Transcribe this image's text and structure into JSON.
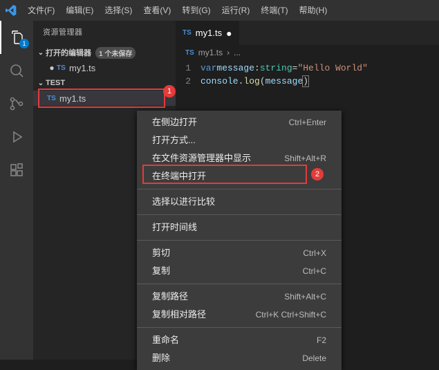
{
  "menubar": {
    "items": [
      "文件(F)",
      "编辑(E)",
      "选择(S)",
      "查看(V)",
      "转到(G)",
      "运行(R)",
      "终端(T)",
      "帮助(H)"
    ]
  },
  "activitybar": {
    "badge": "1"
  },
  "sidebar": {
    "title": "资源管理器",
    "openEditors": {
      "label": "打开的编辑器",
      "badge": "1 个未保存"
    },
    "openFiles": [
      {
        "dot": "●",
        "icon": "TS",
        "name": "my1.ts"
      }
    ],
    "folder": {
      "label": "TEST"
    },
    "folderFiles": [
      {
        "icon": "TS",
        "name": "my1.ts"
      }
    ]
  },
  "editor": {
    "tab": {
      "icon": "TS",
      "name": "my1.ts"
    },
    "breadcrumbs": {
      "icon": "TS",
      "name": "my1.ts",
      "sep": "›",
      "rest": "..."
    },
    "lines": {
      "l1": {
        "n": "1",
        "kw": "var",
        "sp": " ",
        "var": "message",
        "colon": ":",
        "type": "string",
        "sp2": " ",
        "eq": "=",
        "sp3": " ",
        "str": "\"Hello World\""
      },
      "l2": {
        "n": "2",
        "obj": "console",
        "dot": ".",
        "fn": "log",
        "lp": "(",
        "arg": "message",
        "rp": ")"
      }
    }
  },
  "contextMenu": {
    "items": [
      {
        "label": "在侧边打开",
        "shortcut": "Ctrl+Enter"
      },
      {
        "label": "打开方式..."
      },
      {
        "label": "在文件资源管理器中显示",
        "shortcut": "Shift+Alt+R"
      },
      {
        "label": "在终端中打开"
      },
      {
        "sep": true
      },
      {
        "label": "选择以进行比较"
      },
      {
        "sep": true
      },
      {
        "label": "打开时间线"
      },
      {
        "sep": true
      },
      {
        "label": "剪切",
        "shortcut": "Ctrl+X"
      },
      {
        "label": "复制",
        "shortcut": "Ctrl+C"
      },
      {
        "sep": true
      },
      {
        "label": "复制路径",
        "shortcut": "Shift+Alt+C"
      },
      {
        "label": "复制相对路径",
        "shortcut": "Ctrl+K Ctrl+Shift+C"
      },
      {
        "sep": true
      },
      {
        "label": "重命名",
        "shortcut": "F2"
      },
      {
        "label": "删除",
        "shortcut": "Delete"
      }
    ]
  },
  "annotations": {
    "r1": "1",
    "r2": "2"
  }
}
